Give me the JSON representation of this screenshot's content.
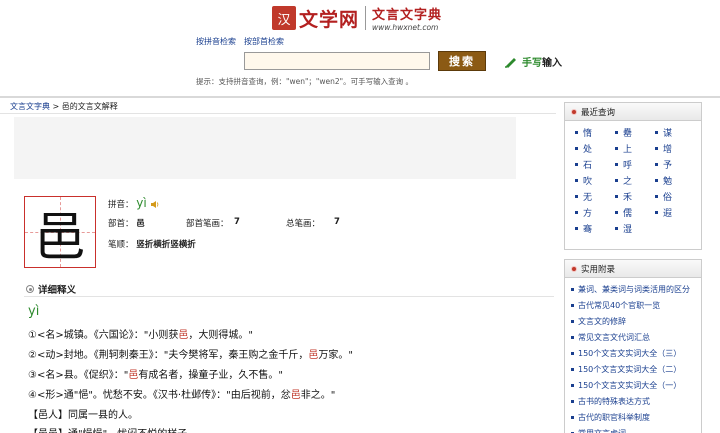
{
  "header": {
    "logo_seal": "汉",
    "logo_text": "文学网",
    "subtitle": "文言文字典",
    "url": "www.hwxnet.com"
  },
  "search": {
    "link_pinyin": "按拼音检索",
    "link_bushou": "按部首检索",
    "query": "",
    "button": "搜索",
    "handwrite_a": "手写",
    "handwrite_b": "输入",
    "tips": "提示：支持拼音查询，例：\"wen\"；\"wen2\"。可手写输入查询 。"
  },
  "breadcrumb": {
    "home": "文言文字典",
    "sep": ">",
    "current": "邑的文言文解释"
  },
  "char": {
    "glyph": "邑",
    "pinyin_label": "拼音：",
    "pinyin": "yì",
    "bushou_label": "部首：",
    "bushou": "邑",
    "bushou_strokes_label": "部首笔画：",
    "bushou_strokes": "7",
    "total_strokes_label": "总笔画：",
    "total_strokes": "7",
    "stroke_order_label": "笔顺：",
    "stroke_order": "竖折横折竖横折"
  },
  "detail": {
    "title": "详细释义",
    "pron": "yì",
    "d1_a": "①<名>城镇。《六国论》：\"小则获",
    "d1_r": "邑",
    "d1_b": "，大则得城。\"",
    "d2_a": "②<动>封地。《荆轲刺秦王》：\"夫今樊将军，秦王购之金千斤，",
    "d2_r": "邑",
    "d2_b": "万家。\"",
    "d3_a": "③<名>县。《促织》：\"",
    "d3_r": "邑",
    "d3_b": "有成名者，操童子业，久不售。\"",
    "d4_a": "④<形>通\"悒\"。忧愁不安。《汉书·杜邺传》：\"由后视前，忿",
    "d4_r": "邑",
    "d4_b": "非之。\"",
    "d5": "【邑人】同属一县的人。",
    "d6": "【邑邑】通\"悒悒\"。忧闷不悦的样子。"
  },
  "sidebar": {
    "recent_title": "最近查询",
    "recent": [
      "惰",
      "罍",
      "谋",
      "处",
      "上",
      "增",
      "石",
      "呼",
      "予",
      "吹",
      "之",
      "勉",
      "无",
      "禾",
      "俗",
      "方",
      "儒",
      "遐",
      "骞",
      "湿"
    ],
    "resources_title": "实用附录",
    "resources": [
      "兼词、兼类词与词类活用的区分",
      "古代常见40个官职一览",
      "文言文的修辞",
      "常见文言文代词汇总",
      "150个文言文实词大全（三）",
      "150个文言文实词大全（二）",
      "150个文言文实词大全（一）",
      "古书的特殊表达方式",
      "古代的职官科举制度",
      "常用文言虚词"
    ]
  },
  "colors": {
    "accent_red": "#c0392b",
    "pinyin_green": "#2e8b2e",
    "link_blue": "#1a3f8f",
    "search_button": "#8b5a14"
  },
  "icons": {
    "speaker": "speaker-icon",
    "pen": "pen-icon",
    "section_bullet": "circle-bullet-icon"
  }
}
